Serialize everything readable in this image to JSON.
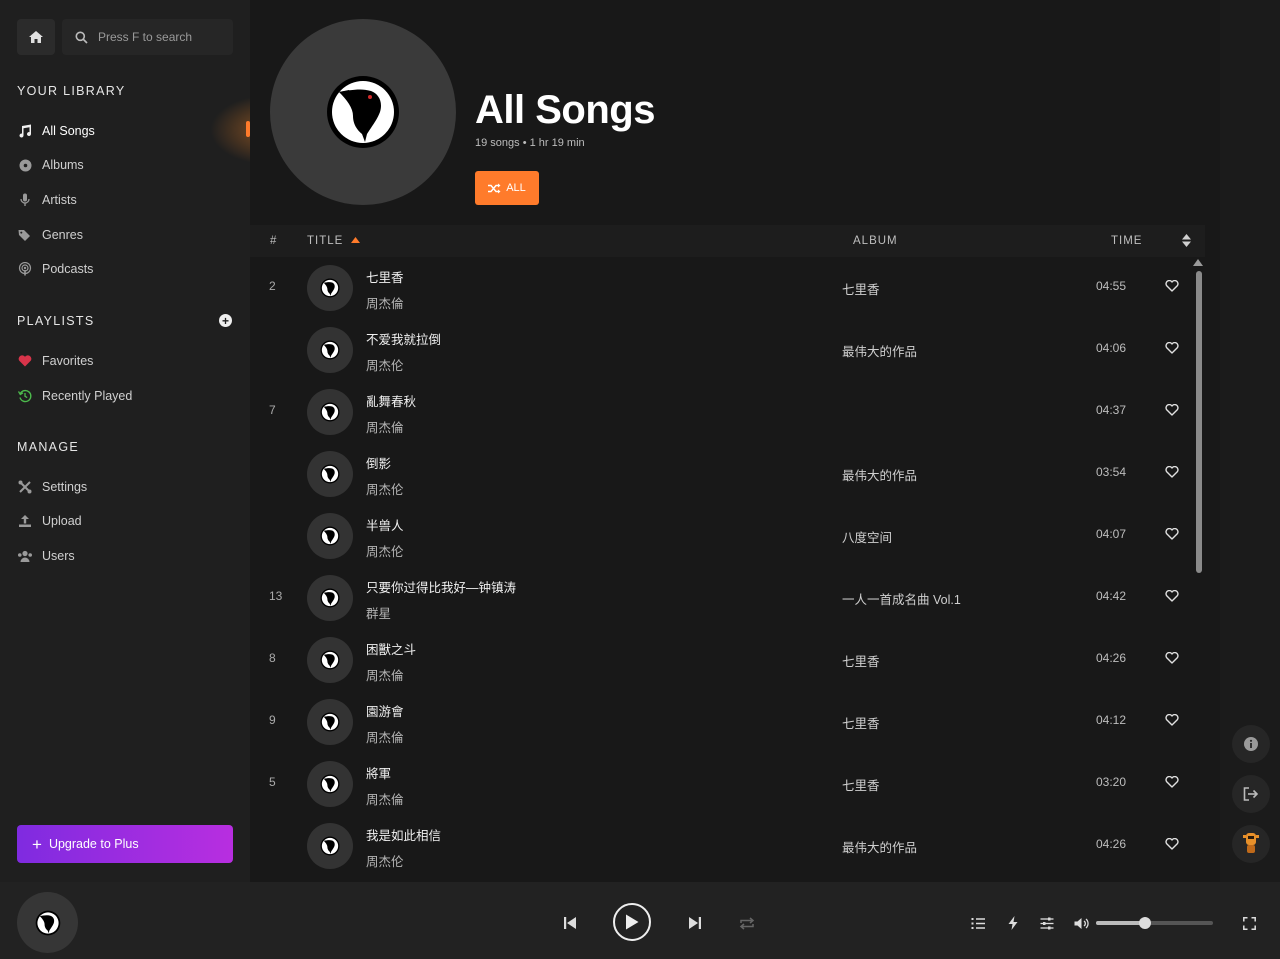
{
  "search": {
    "placeholder": "Press F to search"
  },
  "library": {
    "title": "YOUR LIBRARY",
    "items": [
      {
        "label": "All Songs",
        "icon": "music-note-icon"
      },
      {
        "label": "Albums",
        "icon": "disc-icon"
      },
      {
        "label": "Artists",
        "icon": "microphone-icon"
      },
      {
        "label": "Genres",
        "icon": "tags-icon"
      },
      {
        "label": "Podcasts",
        "icon": "podcast-icon"
      }
    ]
  },
  "playlists": {
    "title": "PLAYLISTS",
    "items": [
      {
        "label": "Favorites",
        "icon": "heart-icon",
        "color": "#e03a4a"
      },
      {
        "label": "Recently Played",
        "icon": "history-icon",
        "color": "#4cba4c"
      }
    ]
  },
  "manage": {
    "title": "MANAGE",
    "items": [
      {
        "label": "Settings",
        "icon": "tools-icon"
      },
      {
        "label": "Upload",
        "icon": "upload-icon"
      },
      {
        "label": "Users",
        "icon": "users-icon"
      }
    ]
  },
  "upgrade": {
    "label": "Upgrade to Plus"
  },
  "header": {
    "title": "All Songs",
    "meta": "19 songs • 1 hr 19 min",
    "shuffle_label": "ALL"
  },
  "table": {
    "col_num": "#",
    "col_title": "TITLE",
    "col_album": "ALBUM",
    "col_time": "TIME",
    "rows": [
      {
        "num": "2",
        "title": "七里香",
        "artist": "周杰倫",
        "album": "七里香",
        "time": "04:55"
      },
      {
        "num": "",
        "title": "不爱我就拉倒",
        "artist": "周杰伦",
        "album": "最伟大的作品",
        "time": "04:06"
      },
      {
        "num": "7",
        "title": "亂舞春秋",
        "artist": "周杰倫",
        "album": "",
        "time": "04:37"
      },
      {
        "num": "",
        "title": "倒影",
        "artist": "周杰伦",
        "album": "最伟大的作品",
        "time": "03:54"
      },
      {
        "num": "",
        "title": "半兽人",
        "artist": "周杰伦",
        "album": "八度空间",
        "time": "04:07"
      },
      {
        "num": "13",
        "title": "只要你过得比我好—钟镇涛",
        "artist": "群星",
        "album": "一人一首成名曲 Vol.1",
        "time": "04:42"
      },
      {
        "num": "8",
        "title": "困獸之斗",
        "artist": "周杰倫",
        "album": "七里香",
        "time": "04:26"
      },
      {
        "num": "9",
        "title": "園游會",
        "artist": "周杰倫",
        "album": "七里香",
        "time": "04:12"
      },
      {
        "num": "5",
        "title": "將軍",
        "artist": "周杰倫",
        "album": "七里香",
        "time": "03:20"
      },
      {
        "num": "",
        "title": "我是如此相信",
        "artist": "周杰伦",
        "album": "最伟大的作品",
        "time": "04:26"
      }
    ]
  },
  "player": {
    "volume": 0.42
  },
  "colors": {
    "accent": "#ff7b2b",
    "upgrade_start": "#7f2be0",
    "upgrade_end": "#b82ee0"
  }
}
